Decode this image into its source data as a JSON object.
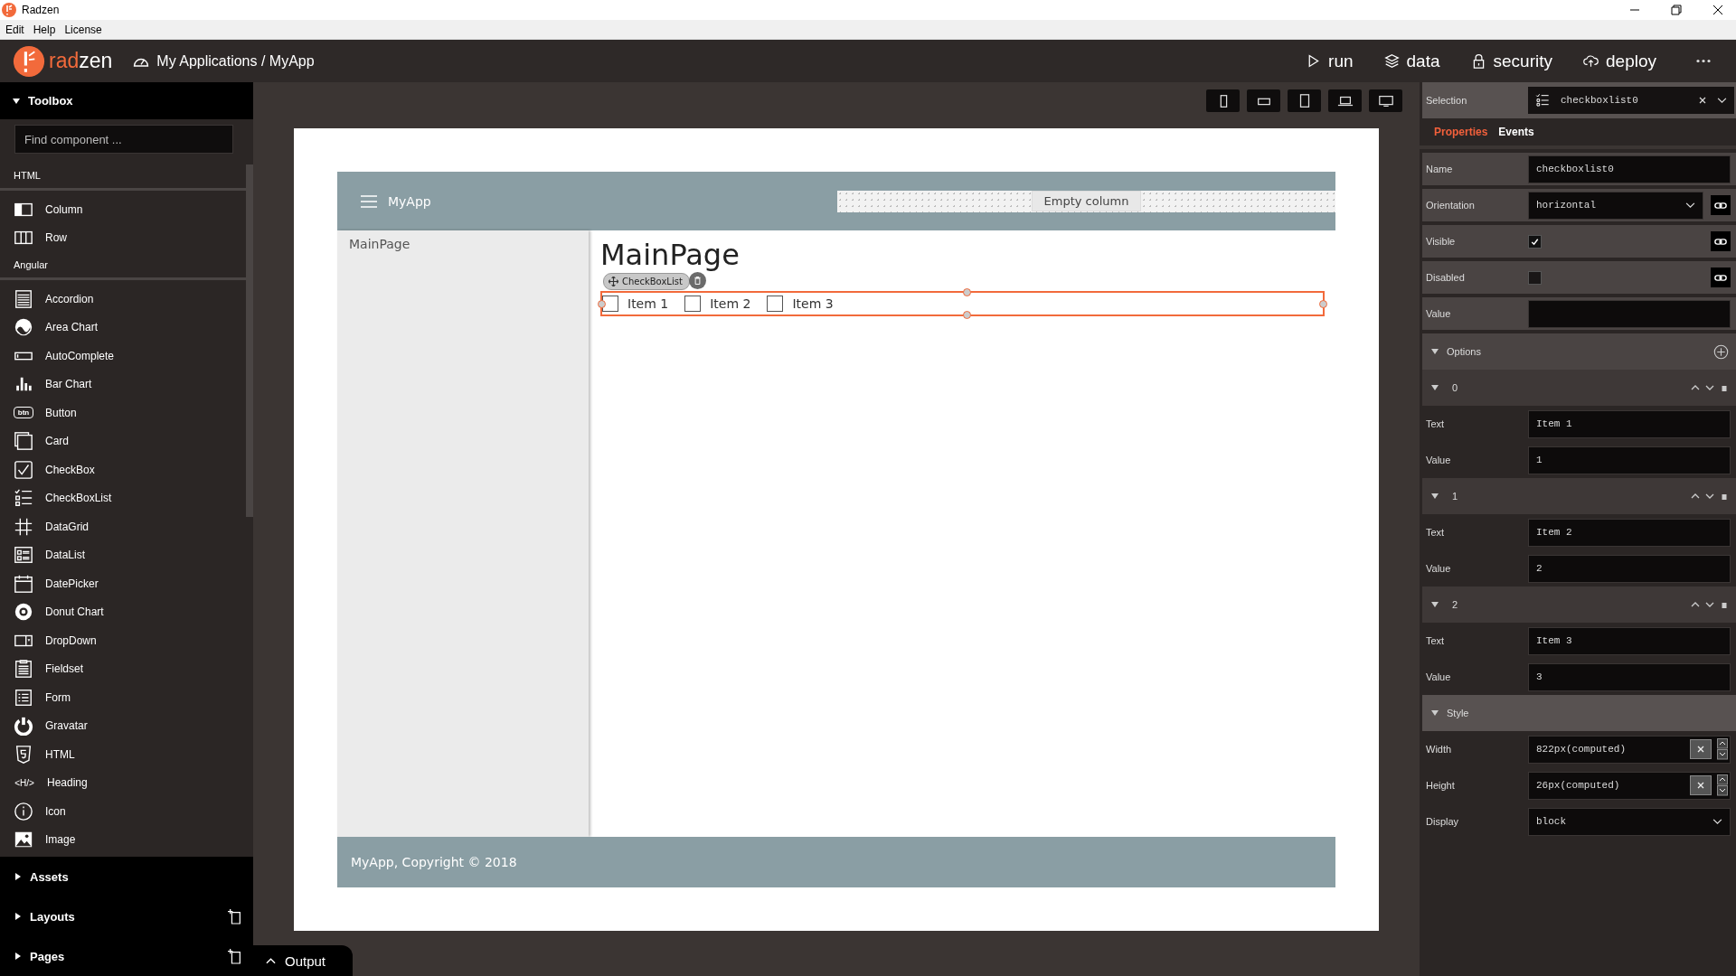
{
  "window": {
    "title": "Radzen"
  },
  "menu": [
    "Edit",
    "Help",
    "License"
  ],
  "topbar": {
    "brand_a": "rad",
    "brand_b": "zen",
    "breadcrumb": "My Applications / MyApp",
    "actions": [
      {
        "label": "run"
      },
      {
        "label": "data"
      },
      {
        "label": "security"
      },
      {
        "label": "deploy"
      }
    ]
  },
  "toolbox": {
    "title": "Toolbox",
    "expanded": true,
    "search": {
      "placeholder": "Find component ..."
    },
    "sections": [
      {
        "title": "HTML",
        "items": [
          {
            "label": "Column"
          },
          {
            "label": "Row"
          }
        ]
      },
      {
        "title": "Angular",
        "items": [
          {
            "label": "Accordion"
          },
          {
            "label": "Area Chart"
          },
          {
            "label": "AutoComplete"
          },
          {
            "label": "Bar Chart"
          },
          {
            "label": "Button",
            "glyph": "btn"
          },
          {
            "label": "Card"
          },
          {
            "label": "CheckBox"
          },
          {
            "label": "CheckBoxList"
          },
          {
            "label": "DataGrid"
          },
          {
            "label": "DataList"
          },
          {
            "label": "DatePicker"
          },
          {
            "label": "Donut Chart"
          },
          {
            "label": "DropDown"
          },
          {
            "label": "Fieldset"
          },
          {
            "label": "Form"
          },
          {
            "label": "Gravatar"
          },
          {
            "label": "HTML"
          },
          {
            "label": "Heading",
            "glyph": "<H/>"
          },
          {
            "label": "Icon"
          },
          {
            "label": "Image"
          }
        ]
      }
    ],
    "panels": [
      {
        "title": "Assets",
        "expanded": false,
        "addable": false
      },
      {
        "title": "Layouts",
        "expanded": false,
        "addable": true
      },
      {
        "title": "Pages",
        "expanded": false,
        "addable": true
      }
    ]
  },
  "canvas": {
    "app_title": "MyApp",
    "empty_column": "Empty column",
    "nav": [
      "MainPage"
    ],
    "heading": "MainPage",
    "selection_tag": "CheckBoxList",
    "checkboxes": [
      {
        "label": "Item 1",
        "checked": false
      },
      {
        "label": "Item 2",
        "checked": false
      },
      {
        "label": "Item 3",
        "checked": false
      }
    ],
    "footer": "MyApp, Copyright © 2018"
  },
  "output": {
    "label": "Output",
    "expanded": false
  },
  "properties": {
    "selection_label": "Selection",
    "selection": "checkboxlist0",
    "tabs": [
      {
        "label": "Properties",
        "selected": true
      },
      {
        "label": "Events",
        "selected": false
      }
    ],
    "rows": [
      {
        "kind": "text",
        "label": "Name",
        "value": "checkboxlist0"
      },
      {
        "kind": "select",
        "label": "Orientation",
        "value": "horizontal",
        "bindable": true
      },
      {
        "kind": "check",
        "label": "Visible",
        "checked": true,
        "bindable": true
      },
      {
        "kind": "check",
        "label": "Disabled",
        "checked": false,
        "bindable": true
      },
      {
        "kind": "text",
        "label": "Value"
      },
      {
        "kind": "section",
        "label": "Options",
        "addable": true
      },
      {
        "kind": "option",
        "label": "0"
      },
      {
        "kind": "text",
        "label": "Text",
        "value": "Item 1"
      },
      {
        "kind": "text",
        "label": "Value",
        "value": "1"
      },
      {
        "kind": "option",
        "label": "1"
      },
      {
        "kind": "text",
        "label": "Text",
        "value": "Item 2"
      },
      {
        "kind": "text",
        "label": "Value",
        "value": "2"
      },
      {
        "kind": "option",
        "label": "2"
      },
      {
        "kind": "text",
        "label": "Text",
        "value": "Item 3"
      },
      {
        "kind": "text",
        "label": "Value",
        "value": "3"
      },
      {
        "kind": "section",
        "label": "Style",
        "addable": false
      },
      {
        "kind": "size",
        "label": "Width",
        "value": "822px(computed)"
      },
      {
        "kind": "size",
        "label": "Height",
        "value": "26px(computed)"
      },
      {
        "kind": "select",
        "label": "Display",
        "value": "block",
        "bindable": false
      }
    ]
  }
}
